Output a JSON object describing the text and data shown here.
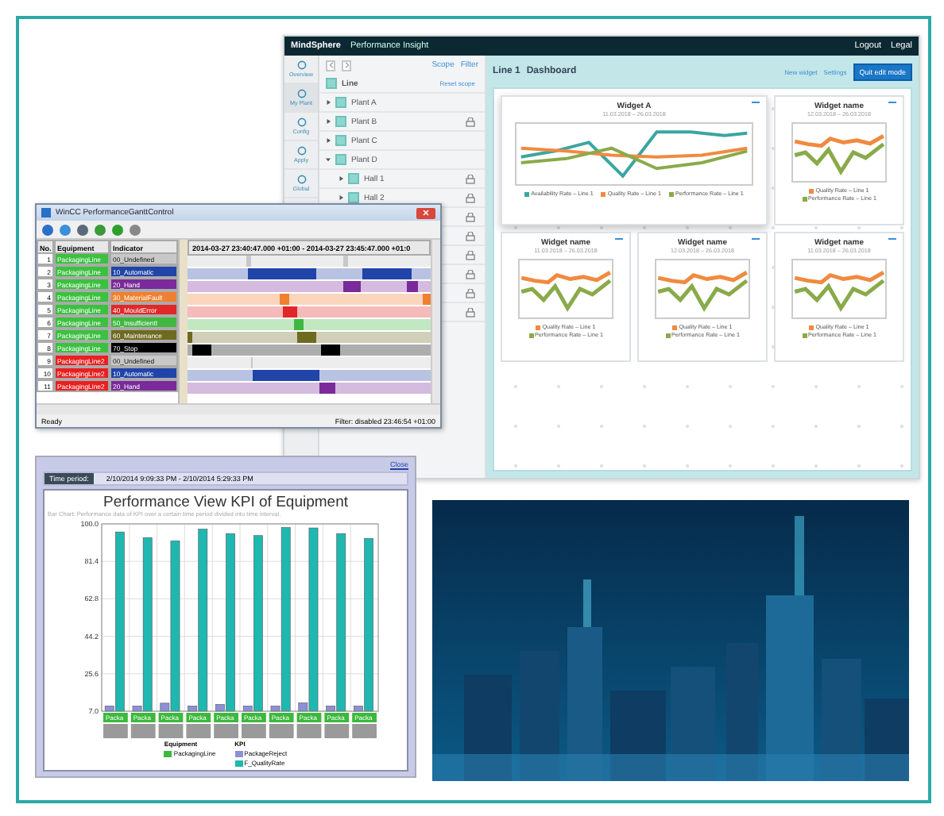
{
  "mindsphere": {
    "brand": "MindSphere",
    "app": "Performance Insight",
    "header_links": [
      "Logout",
      "Legal"
    ],
    "nav": [
      {
        "label": "Overview",
        "selected": false
      },
      {
        "label": "My Plant",
        "selected": true
      },
      {
        "label": "Config",
        "selected": false
      },
      {
        "label": "Apply",
        "selected": false
      },
      {
        "label": "Global",
        "selected": false
      }
    ],
    "tree_toolbar": [
      "Scope",
      "Filter"
    ],
    "root": "Line",
    "reset": "Reset scope",
    "tree": [
      {
        "label": "Plant A",
        "locked": false,
        "expanded": false
      },
      {
        "label": "Plant B",
        "locked": true,
        "expanded": false
      },
      {
        "label": "Plant C",
        "locked": false,
        "expanded": false
      },
      {
        "label": "Plant D",
        "locked": false,
        "expanded": true,
        "children": [
          {
            "label": "Hall 1",
            "locked": true,
            "expanded": false
          },
          {
            "label": "Hall 2",
            "locked": true,
            "expanded": false
          }
        ]
      }
    ],
    "breadcrumb": [
      "Line 1",
      "Dashboard"
    ],
    "actions": [
      "New widget",
      "Settings"
    ],
    "primary_action": "Quit edit mode",
    "widgets": [
      {
        "kind": "wide",
        "title": "Widget A",
        "dates": "11.03.2018 – 26.03.2018",
        "legend": [
          {
            "label": "Availability Rate – Line 1",
            "color": "#3aa6a0"
          },
          {
            "label": "Quality Rate – Line 1",
            "color": "#f08a40"
          },
          {
            "label": "Performance Rate – Line 1",
            "color": "#8aaa4a"
          }
        ]
      },
      {
        "kind": "normal",
        "title": "Widget name",
        "dates": "12.03.2018 – 26.03.2018",
        "legend": [
          {
            "label": "Quality Rate – Line 1",
            "color": "#f08a40"
          },
          {
            "label": "Performance Rate – Line 1",
            "color": "#8aaa4a"
          }
        ]
      },
      {
        "kind": "normal",
        "title": "Widget name",
        "dates": "11.03.2018 – 26.03.2018",
        "legend": [
          {
            "label": "Quality Rate – Line 1",
            "color": "#f08a40"
          },
          {
            "label": "Performance Rate – Line 1",
            "color": "#8aaa4a"
          }
        ]
      },
      {
        "kind": "normal",
        "title": "Widget name",
        "dates": "12.03.2018 – 26.03.2018",
        "legend": [
          {
            "label": "Quality Rate – Line 1",
            "color": "#f08a40"
          },
          {
            "label": "Performance Rate – Line 1",
            "color": "#8aaa4a"
          }
        ]
      },
      {
        "kind": "normal",
        "title": "Widget name",
        "dates": "11.03.2018 – 26.03.2018",
        "legend": [
          {
            "label": "Quality Rate – Line 1",
            "color": "#f08a40"
          },
          {
            "label": "Performance Rate – Line 1",
            "color": "#8aaa4a"
          }
        ]
      }
    ]
  },
  "wincc": {
    "title": "WinCC PerformanceGanttControl",
    "columns": [
      "No.",
      "Equipment",
      "Indicator"
    ],
    "time_range": "2014-03-27 23:40:47.000 +01:00 - 2014-03-27 23:45:47.000 +01:0",
    "rows": [
      {
        "no": "1",
        "equipment": {
          "label": "PackagingLine",
          "color": "#3cc040"
        },
        "indicator": {
          "label": "00_Undefined",
          "color": "#c8c8c8"
        }
      },
      {
        "no": "2",
        "equipment": {
          "label": "PackagingLine",
          "color": "#3cc040"
        },
        "indicator": {
          "label": "10_Automatic",
          "color": "#2044a8"
        }
      },
      {
        "no": "3",
        "equipment": {
          "label": "PackagingLine",
          "color": "#3cc040"
        },
        "indicator": {
          "label": "20_Hand",
          "color": "#7a2a9a"
        }
      },
      {
        "no": "4",
        "equipment": {
          "label": "PackagingLine",
          "color": "#3cc040"
        },
        "indicator": {
          "label": "30_MaterialFault",
          "color": "#f08030"
        }
      },
      {
        "no": "5",
        "equipment": {
          "label": "PackagingLine",
          "color": "#3cc040"
        },
        "indicator": {
          "label": "40_MouldError",
          "color": "#e02828"
        }
      },
      {
        "no": "6",
        "equipment": {
          "label": "PackagingLine",
          "color": "#3cc040"
        },
        "indicator": {
          "label": "50_InsufficientI",
          "color": "#40b840"
        }
      },
      {
        "no": "7",
        "equipment": {
          "label": "PackagingLine",
          "color": "#3cc040"
        },
        "indicator": {
          "label": "60_Maintenance",
          "color": "#6e6a20"
        }
      },
      {
        "no": "8",
        "equipment": {
          "label": "PackagingLine",
          "color": "#3cc040"
        },
        "indicator": {
          "label": "70_Stop",
          "color": "#000000"
        }
      },
      {
        "no": "9",
        "equipment": {
          "label": "PackagingLine2",
          "color": "#e82020"
        },
        "indicator": {
          "label": "00_Undefined",
          "color": "#c8c8c8"
        }
      },
      {
        "no": "10",
        "equipment": {
          "label": "PackagingLine2",
          "color": "#e82020"
        },
        "indicator": {
          "label": "10_Automatic",
          "color": "#2044a8"
        }
      },
      {
        "no": "11",
        "equipment": {
          "label": "PackagingLine2",
          "color": "#e82020"
        },
        "indicator": {
          "label": "20_Hand",
          "color": "#7a2a9a"
        }
      }
    ],
    "status": "Ready",
    "filter_status": "Filter: disabled   23:46:54 +01:00"
  },
  "kpi": {
    "close": "Close",
    "period_label": "Time period:",
    "period": "2/10/2014 9:09:33 PM - 2/10/2014 5:29:33 PM",
    "chart_data": {
      "type": "bar",
      "title": "Performance View KPI of Equipment",
      "subtitle": "Bar Chart: Performance data of KPI over a certain time period divided into time interval.",
      "categories": [
        "Packa",
        "Packa",
        "Packa",
        "Packa",
        "Packa",
        "Packa",
        "Packa",
        "Packa",
        "Packa",
        "Packa"
      ],
      "series": [
        {
          "name": "PackageReject",
          "color": "#8c90d8",
          "values": [
            9.6,
            9.6,
            11.0,
            9.6,
            10.4,
            9.6,
            9.6,
            11.2,
            9.6,
            9.6
          ]
        },
        {
          "name": "F_QualityRate",
          "color": "#1fb8b0",
          "values": [
            96,
            93.2,
            91.6,
            97.4,
            95.2,
            94.2,
            98.2,
            98,
            95.2,
            92.8
          ]
        }
      ],
      "ylim": [
        7,
        100
      ],
      "grid": true,
      "yticks": [
        {
          "value": 7,
          "label": "7.0"
        },
        {
          "value": 25.6,
          "label": "25.6"
        },
        {
          "value": 44.2,
          "label": "44.2"
        },
        {
          "value": 62.8,
          "label": "62.8"
        },
        {
          "value": 81.4,
          "label": "81.4"
        },
        {
          "value": 100,
          "label": "100.0"
        }
      ]
    },
    "legend": {
      "equipment_title": "Equipment",
      "equipment": [
        {
          "label": "PackagingLine",
          "color": "#3cb83c"
        }
      ],
      "kpi_title": "KPI"
    }
  }
}
